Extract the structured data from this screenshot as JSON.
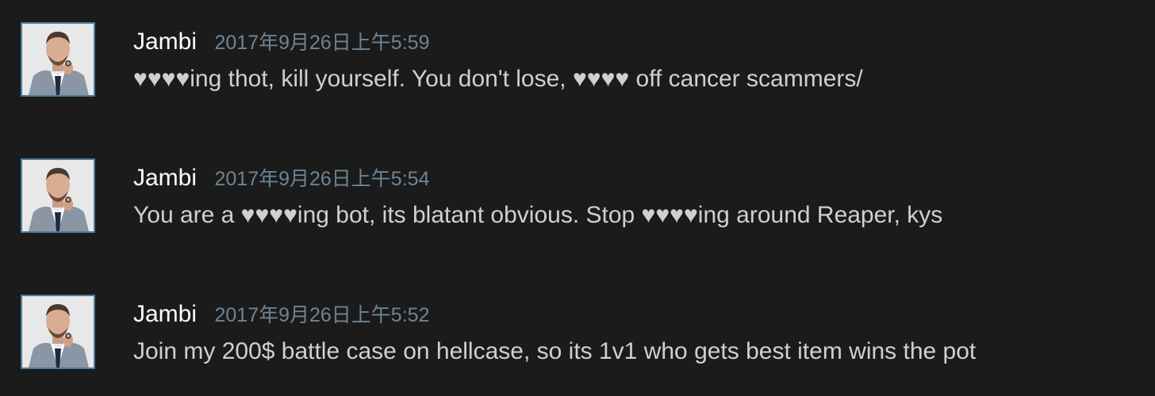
{
  "comments": [
    {
      "author": "Jambi",
      "timestamp": "2017年9月26日上午5:59",
      "text": "♥♥♥♥ing thot, kill yourself. You don't lose, ♥♥♥♥ off cancer scammers/",
      "avatar_icon": "profile-avatar"
    },
    {
      "author": "Jambi",
      "timestamp": "2017年9月26日上午5:54",
      "text": "You are a ♥♥♥♥ing bot, its blatant obvious. Stop ♥♥♥♥ing around Reaper, kys",
      "avatar_icon": "profile-avatar"
    },
    {
      "author": "Jambi",
      "timestamp": "2017年9月26日上午5:52",
      "text": "Join my 200$ battle case on hellcase, so its 1v1 who gets best item wins the pot",
      "avatar_icon": "profile-avatar"
    }
  ],
  "colors": {
    "background": "#1b1b1b",
    "author": "#ffffff",
    "timestamp": "#6e8493",
    "text": "#d0d0d0",
    "avatar_border": "#4b7d9c"
  }
}
